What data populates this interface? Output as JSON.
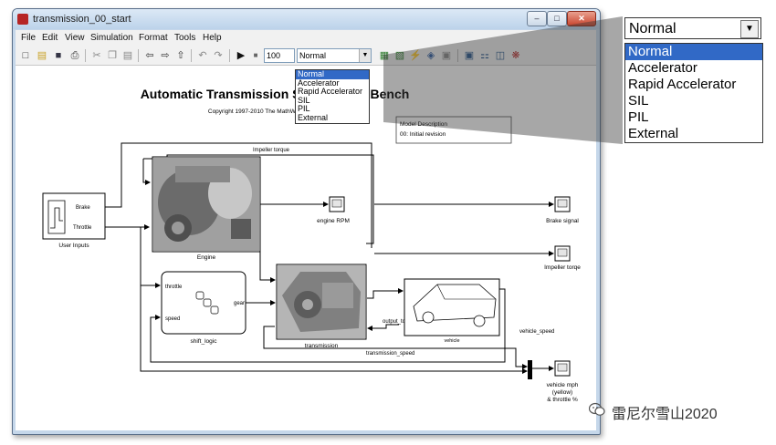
{
  "window": {
    "title": "transmission_00_start",
    "minimize_glyph": "–",
    "maximize_glyph": "□",
    "close_glyph": "✕"
  },
  "menu": [
    "File",
    "Edit",
    "View",
    "Simulation",
    "Format",
    "Tools",
    "Help"
  ],
  "toolbar": {
    "stop_time": "100",
    "sim_mode": "Normal",
    "sim_mode_options": [
      "Normal",
      "Accelerator",
      "Rapid Accelerator",
      "SIL",
      "PIL",
      "External"
    ]
  },
  "diagram": {
    "title": "Automatic Transmission System Test Bench",
    "copyright": "Copyright 1997-2010 The MathWorks, Inc.",
    "model_description": {
      "heading": "Model Description",
      "text": "00: Initial revision"
    },
    "blocks": {
      "user_inputs": "User Inputs",
      "brake_port": "Brake",
      "throttle_port": "Throttle",
      "engine": "Engine",
      "engine_rpm": "engine RPM",
      "brake_signal": "Brake signal",
      "impeller_torque_scope": "Impeller torqe",
      "shift_logic": "shift_logic",
      "throttle_in": "throttle",
      "speed_in": "speed",
      "gear_out": "gear",
      "transmission": "transmission",
      "vehicle": "vehicle",
      "vehicle_mph": "vehicle mph",
      "vehicle_mph_2": "(yellow)",
      "vehicle_mph_3": "& throttle %"
    },
    "signals": {
      "impeller_torque": "Impeller torque",
      "output_torque": "output_torque",
      "transmission_speed": "transmission_speed",
      "vehicle_speed": "vehicle_speed"
    }
  },
  "zoom_callout": {
    "value": "Normal",
    "options": [
      "Normal",
      "Accelerator",
      "Rapid Accelerator",
      "SIL",
      "PIL",
      "External"
    ]
  },
  "watermark": {
    "text": "雷尼尔雪山2020"
  }
}
